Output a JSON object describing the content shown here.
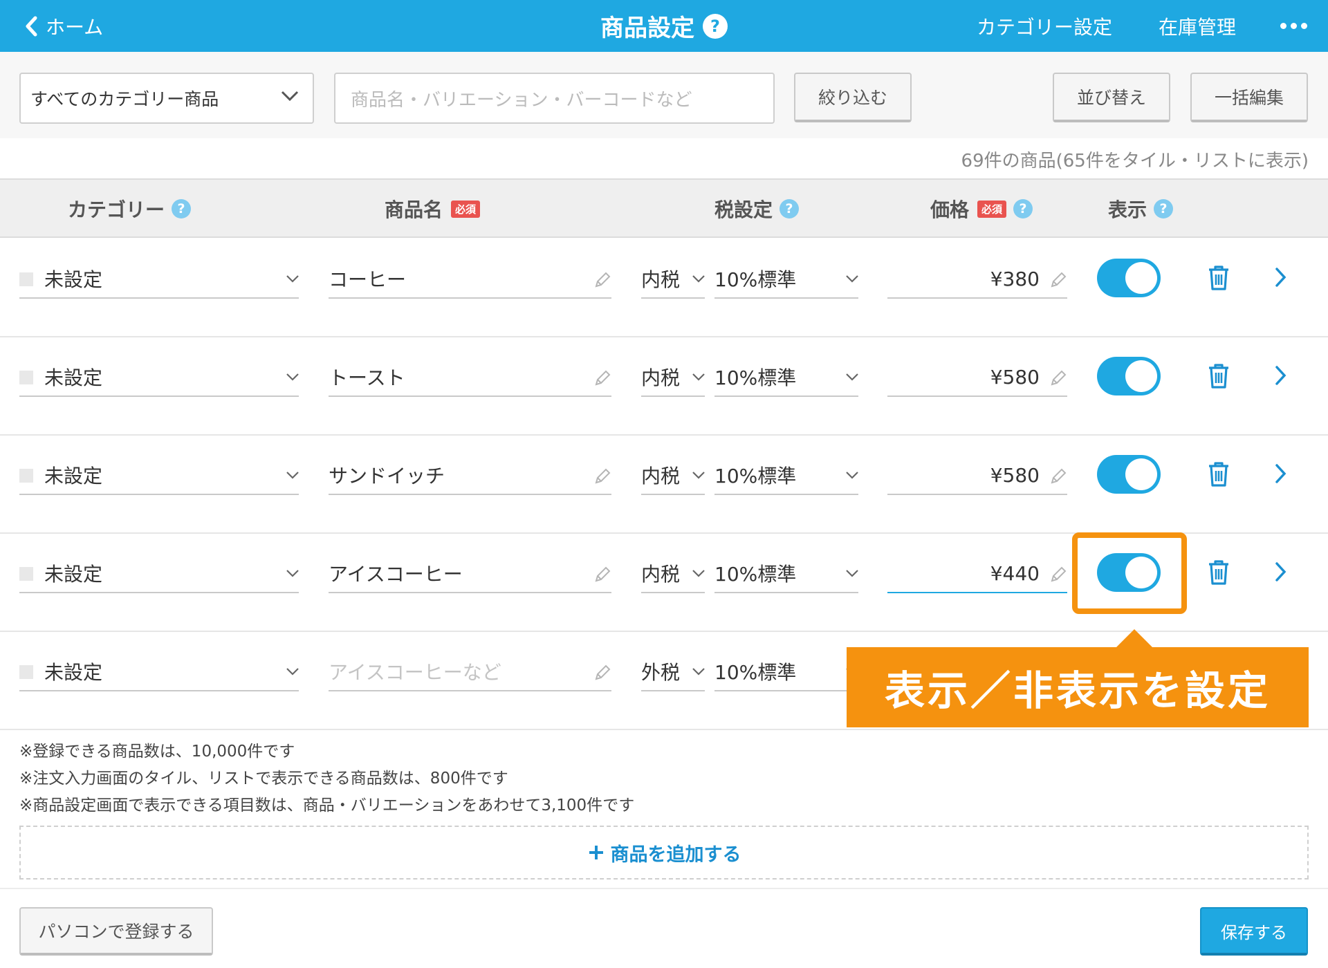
{
  "header": {
    "back_label": "ホーム",
    "title": "商品設定",
    "help_glyph": "?",
    "category_settings": "カテゴリー設定",
    "inventory": "在庫管理"
  },
  "filter": {
    "category_selected": "すべてのカテゴリー商品",
    "search_placeholder": "商品名・バリエーション・バーコードなど",
    "filter_button": "絞り込む",
    "sort_button": "並び替え",
    "bulk_edit_button": "一括編集"
  },
  "count_text": "69件の商品(65件をタイル・リストに表示)",
  "table": {
    "headers": {
      "category": "カテゴリー",
      "name": "商品名",
      "tax": "税設定",
      "price": "価格",
      "display": "表示",
      "required": "必須"
    },
    "rows": [
      {
        "category": "未設定",
        "name": "コーヒー",
        "tax_type": "内税",
        "tax_rate": "10%標準",
        "price": "¥380",
        "visible": true
      },
      {
        "category": "未設定",
        "name": "トースト",
        "tax_type": "内税",
        "tax_rate": "10%標準",
        "price": "¥580",
        "visible": true
      },
      {
        "category": "未設定",
        "name": "サンドイッチ",
        "tax_type": "内税",
        "tax_rate": "10%標準",
        "price": "¥580",
        "visible": true
      },
      {
        "category": "未設定",
        "name": "アイスコーヒー",
        "tax_type": "内税",
        "tax_rate": "10%標準",
        "price": "¥440",
        "visible": true
      },
      {
        "category": "未設定",
        "name_placeholder": "アイスコーヒーなど",
        "tax_type": "外税",
        "tax_rate": "10%標準"
      }
    ]
  },
  "notes": [
    "※登録できる商品数は、10,000件です",
    "※注文入力画面のタイル、リストで表示できる商品数は、800件です",
    "※商品設定画面で表示できる項目数は、商品・バリエーションをあわせて3,100件です"
  ],
  "add_product": "商品を追加する",
  "pc_register": "パソコンで登録する",
  "save": "保存する",
  "callout": "表示／非表示を設定",
  "colors": {
    "primary": "#1fa8e1",
    "accent": "#f5920f",
    "required": "#e9534f"
  }
}
